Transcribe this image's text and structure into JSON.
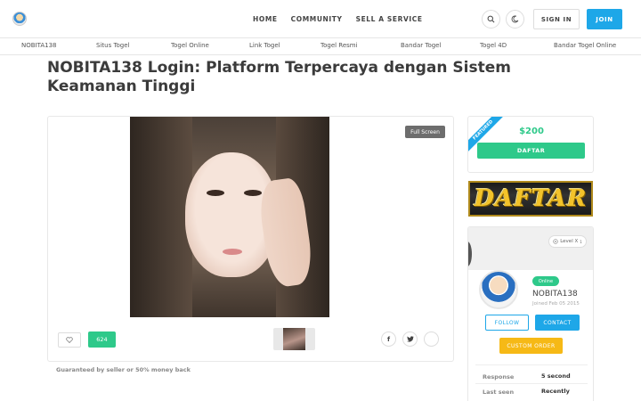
{
  "header": {
    "nav": [
      "HOME",
      "COMMUNITY",
      "SELL A SERVICE"
    ],
    "sign_in": "SIGN IN",
    "join": "JOIN",
    "icons": [
      "logo-avatar",
      "search-icon",
      "moon-icon"
    ]
  },
  "categories": [
    "NOBITA138",
    "Situs Togel",
    "Togel Online",
    "Link Togel",
    "Togel Resmi",
    "Bandar Togel",
    "Togel 4D",
    "Bandar Togel Online"
  ],
  "page": {
    "title": "NOBITA138 Login: Platform Terpercaya dengan Sistem Keamanan Tinggi"
  },
  "media": {
    "fullscreen_label": "Full Screen",
    "like_count": "624",
    "share_icons": [
      "facebook-icon",
      "twitter-icon",
      "more-icon"
    ]
  },
  "guarantee": "Guaranteed by seller or 50% money back",
  "pricing": {
    "ribbon": "FEATURED",
    "price": "$200",
    "button": "DAFTAR"
  },
  "banner": {
    "text": "DAFTAR"
  },
  "seller": {
    "level": "Level X",
    "level_sup": "1",
    "status": "Online",
    "username": "NOBITA138",
    "joined": "Joined Feb 05 2015",
    "follow": "FOLLOW",
    "contact": "CONTACT",
    "custom_order": "CUSTOM ORDER",
    "stats": [
      {
        "label": "Response",
        "value": "5 second"
      },
      {
        "label": "Last seen",
        "value": "Recently"
      }
    ]
  },
  "colors": {
    "accent_blue": "#1ea7e8",
    "accent_green": "#2ec98a",
    "accent_yellow": "#f6b916"
  }
}
